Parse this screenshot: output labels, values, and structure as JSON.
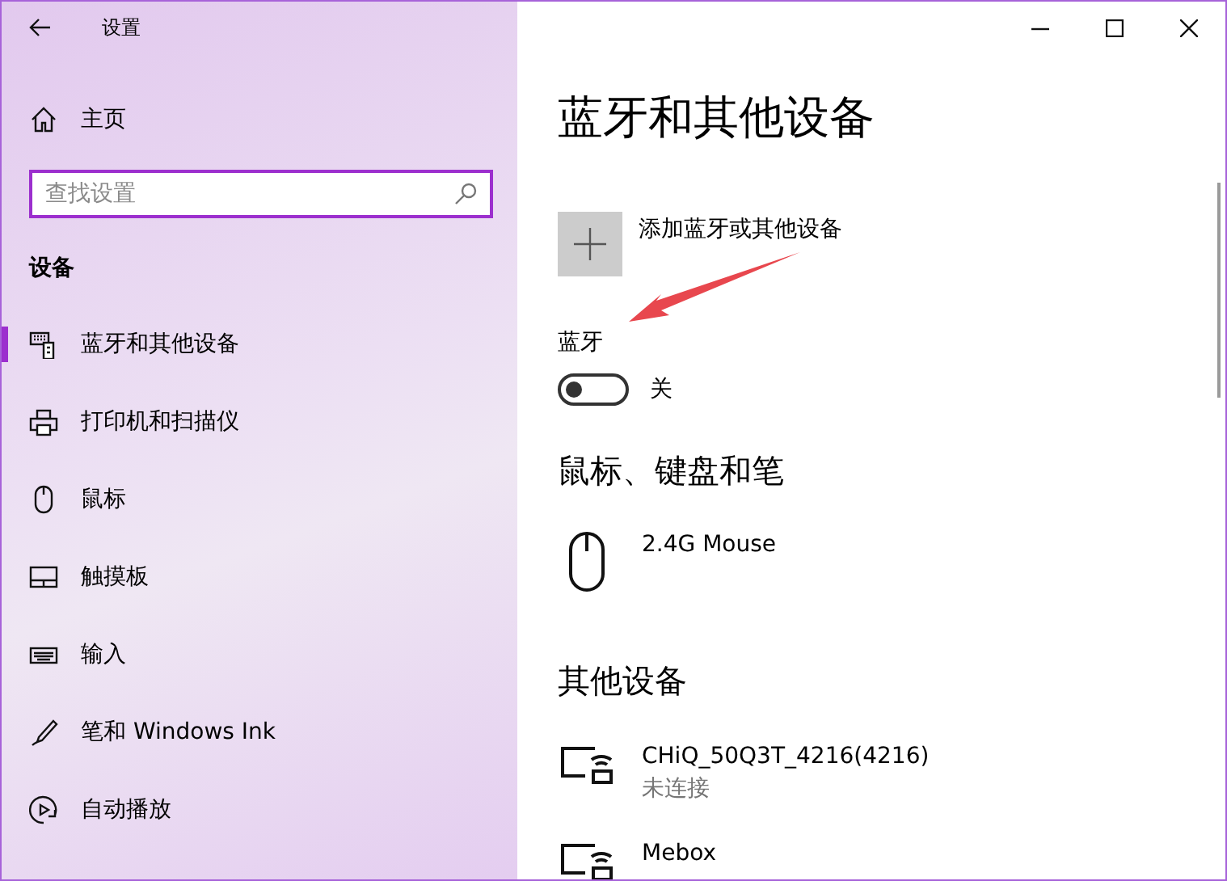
{
  "window": {
    "title": "设置"
  },
  "sidebar": {
    "home": "主页",
    "search": {
      "placeholder": "查找设置"
    },
    "section": "设备",
    "items": [
      {
        "label": "蓝牙和其他设备",
        "kind": "devices",
        "selected": true
      },
      {
        "label": "打印机和扫描仪",
        "kind": "printer",
        "selected": false
      },
      {
        "label": "鼠标",
        "kind": "mouse",
        "selected": false
      },
      {
        "label": "触摸板",
        "kind": "touchpad",
        "selected": false
      },
      {
        "label": "输入",
        "kind": "keyboard",
        "selected": false
      },
      {
        "label": "笔和 Windows Ink",
        "kind": "pen",
        "selected": false
      },
      {
        "label": "自动播放",
        "kind": "autoplay",
        "selected": false
      }
    ]
  },
  "main": {
    "heading": "蓝牙和其他设备",
    "add_device": "添加蓝牙或其他设备",
    "bluetooth": {
      "label": "蓝牙",
      "on": false,
      "state_text": "关"
    },
    "groups": [
      {
        "title": "鼠标、键盘和笔",
        "devices": [
          {
            "name": "2.4G Mouse",
            "kind": "mouse"
          }
        ]
      },
      {
        "title": "其他设备",
        "devices": [
          {
            "name": "CHiQ_50Q3T_4216(4216)",
            "status": "未连接",
            "kind": "display"
          },
          {
            "name": "Mebox",
            "kind": "display"
          }
        ]
      }
    ]
  }
}
